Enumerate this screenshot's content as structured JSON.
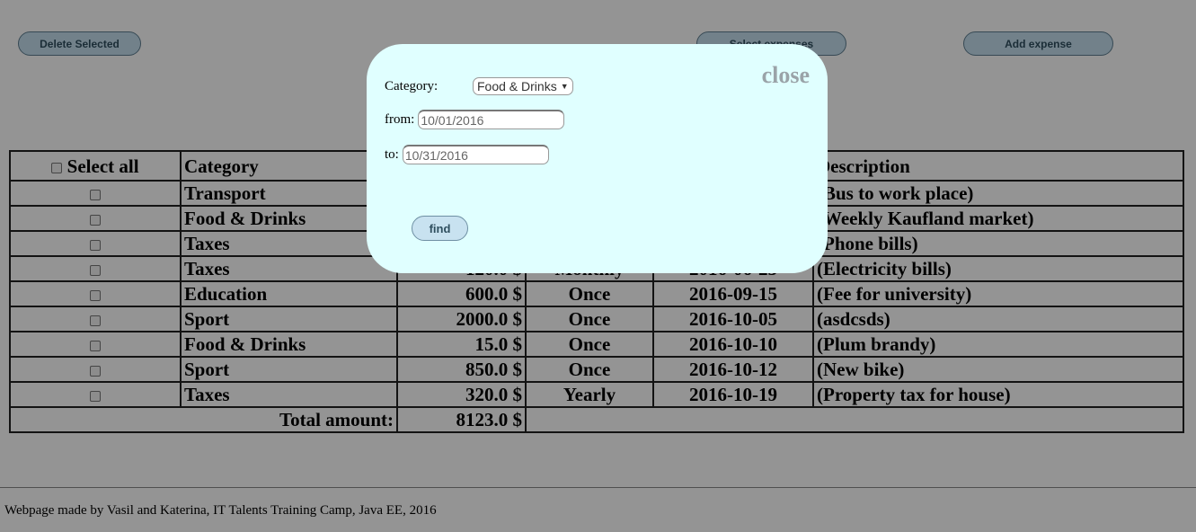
{
  "toolbar": {
    "delete_label": "Delete Selected",
    "select_label": "Select expenses",
    "add_label": "Add expense"
  },
  "table": {
    "headers": {
      "select_all": "Select all",
      "category": "Category",
      "description": "Description"
    },
    "rows": [
      {
        "category": "Transport",
        "amount": "",
        "frequency": "",
        "date": "",
        "description": "(Bus to work place)"
      },
      {
        "category": "Food & Drinks",
        "amount": "",
        "frequency": "",
        "date": "",
        "description": "(Weekly Kaufland market)"
      },
      {
        "category": "Taxes",
        "amount": "",
        "frequency": "",
        "date": "",
        "description": "(Phone bills)"
      },
      {
        "category": "Taxes",
        "amount": "120.0 $",
        "frequency": "Monthly",
        "date": "2016-06-23",
        "description": "(Electricity bills)"
      },
      {
        "category": "Education",
        "amount": "600.0 $",
        "frequency": "Once",
        "date": "2016-09-15",
        "description": "(Fee for university)"
      },
      {
        "category": "Sport",
        "amount": "2000.0 $",
        "frequency": "Once",
        "date": "2016-10-05",
        "description": "(asdcsds)"
      },
      {
        "category": "Food & Drinks",
        "amount": "15.0 $",
        "frequency": "Once",
        "date": "2016-10-10",
        "description": "(Plum brandy)"
      },
      {
        "category": "Sport",
        "amount": "850.0 $",
        "frequency": "Once",
        "date": "2016-10-12",
        "description": "(New bike)"
      },
      {
        "category": "Taxes",
        "amount": "320.0 $",
        "frequency": "Yearly",
        "date": "2016-10-19",
        "description": "(Property tax for house)"
      }
    ],
    "total_label": "Total amount:",
    "total_value": "8123.0  $"
  },
  "footer": {
    "text": "Webpage made by Vasil and Katerina, IT Talents Training Camp, Java EE, 2016"
  },
  "modal": {
    "close_label": "close",
    "category_label": "Category:",
    "category_value": "Food & Drinks",
    "from_label": "from:",
    "from_value": "10/01/2016",
    "to_label": "to:",
    "to_value": "10/31/2016",
    "find_label": "find"
  },
  "colors": {
    "overlay": "rgba(0,0,0,0.42)",
    "modal_bg": "#e0ffff",
    "button_bg": "#c5dfee"
  }
}
